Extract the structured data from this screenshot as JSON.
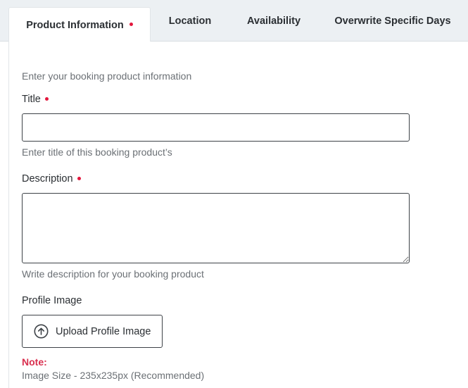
{
  "tabs": [
    {
      "label": "Product Information",
      "active": true,
      "required": true
    },
    {
      "label": "Location",
      "active": false,
      "required": false
    },
    {
      "label": "Availability",
      "active": false,
      "required": false
    },
    {
      "label": "Overwrite Specific Days",
      "active": false,
      "required": false
    }
  ],
  "form": {
    "intro": "Enter your booking product information",
    "title": {
      "label": "Title",
      "required": true,
      "value": "",
      "help": "Enter title of this booking product’s"
    },
    "description": {
      "label": "Description",
      "required": true,
      "value": "",
      "help": "Write description for your booking product"
    },
    "profile_image": {
      "label": "Profile Image",
      "button_label": "Upload Profile Image",
      "button_icon": "upload-arrow-circle-icon"
    },
    "note": {
      "label": "Note:",
      "text": "Image Size - 235x235px (Recommended)"
    }
  },
  "colors": {
    "required_dot": "#e3173d",
    "note_label": "#d9304f",
    "tabbar_bg": "#ecf0f3",
    "text_primary": "#2b2f33",
    "text_muted": "#6b7075"
  }
}
